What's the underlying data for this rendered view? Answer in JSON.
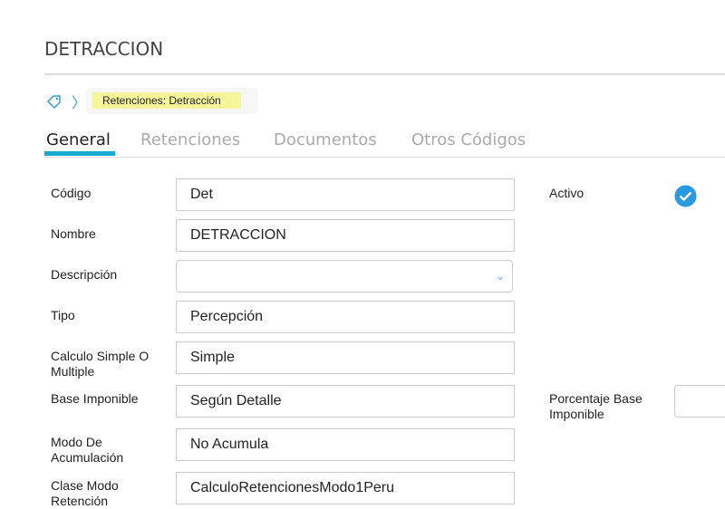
{
  "title": "DETRACCION",
  "breadcrumb": "Retenciones: Detracción",
  "tabs": [
    "General",
    "Retenciones",
    "Documentos",
    "Otros Códigos"
  ],
  "fields": [
    {
      "label": "Código",
      "value": "Det"
    },
    {
      "label": "Nombre",
      "value": "DETRACCION"
    },
    {
      "label": "Descripción",
      "value": ""
    },
    {
      "label": "Tipo",
      "value": "Percepción"
    },
    {
      "label": "Calculo Simple O Multiple",
      "value": "Simple"
    },
    {
      "label": "Base Imponible",
      "value": "Según Detalle"
    },
    {
      "label": "Modo De Acumulación",
      "value": "No Acumula"
    },
    {
      "label": "Clase Modo Retención",
      "value": "CalculoRetencionesModo1Peru"
    }
  ],
  "right": {
    "activo_label": "Activo",
    "activo_checked": true,
    "porcentaje_label": "Porcentaje Base Imponible",
    "porcentaje_value": ""
  },
  "colors": {
    "accent": "#1aa9d0",
    "check": "#2a9ae0",
    "highlight": "#f5f59a"
  }
}
